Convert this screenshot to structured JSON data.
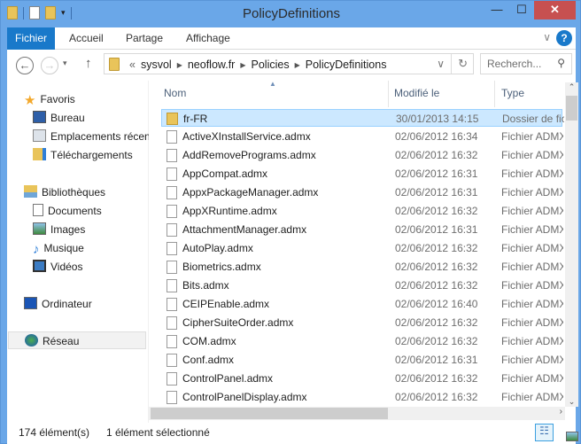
{
  "window": {
    "title": "PolicyDefinitions"
  },
  "ribbon": {
    "tabs": [
      "Fichier",
      "Accueil",
      "Partage",
      "Affichage"
    ]
  },
  "address": {
    "prefix": "«",
    "crumbs": [
      "sysvol",
      "neoflow.fr",
      "Policies",
      "PolicyDefinitions"
    ],
    "search_placeholder": "Recherch..."
  },
  "sidebar": {
    "favorites": {
      "label": "Favoris",
      "items": [
        "Bureau",
        "Emplacements récents",
        "Téléchargements"
      ]
    },
    "libraries": {
      "label": "Bibliothèques",
      "items": [
        "Documents",
        "Images",
        "Musique",
        "Vidéos"
      ]
    },
    "computer": "Ordinateur",
    "network": "Réseau"
  },
  "columns": {
    "name": "Nom",
    "modified": "Modifié le",
    "type": "Type"
  },
  "files": [
    {
      "name": "fr-FR",
      "modified": "30/01/2013 14:15",
      "type": "Dossier de fichiers",
      "folder": true
    },
    {
      "name": "ActiveXInstallService.admx",
      "modified": "02/06/2012 16:34",
      "type": "Fichier ADMX"
    },
    {
      "name": "AddRemovePrograms.admx",
      "modified": "02/06/2012 16:32",
      "type": "Fichier ADMX"
    },
    {
      "name": "AppCompat.admx",
      "modified": "02/06/2012 16:31",
      "type": "Fichier ADMX"
    },
    {
      "name": "AppxPackageManager.admx",
      "modified": "02/06/2012 16:31",
      "type": "Fichier ADMX"
    },
    {
      "name": "AppXRuntime.admx",
      "modified": "02/06/2012 16:32",
      "type": "Fichier ADMX"
    },
    {
      "name": "AttachmentManager.admx",
      "modified": "02/06/2012 16:31",
      "type": "Fichier ADMX"
    },
    {
      "name": "AutoPlay.admx",
      "modified": "02/06/2012 16:32",
      "type": "Fichier ADMX"
    },
    {
      "name": "Biometrics.admx",
      "modified": "02/06/2012 16:32",
      "type": "Fichier ADMX"
    },
    {
      "name": "Bits.admx",
      "modified": "02/06/2012 16:32",
      "type": "Fichier ADMX"
    },
    {
      "name": "CEIPEnable.admx",
      "modified": "02/06/2012 16:40",
      "type": "Fichier ADMX"
    },
    {
      "name": "CipherSuiteOrder.admx",
      "modified": "02/06/2012 16:32",
      "type": "Fichier ADMX"
    },
    {
      "name": "COM.admx",
      "modified": "02/06/2012 16:32",
      "type": "Fichier ADMX"
    },
    {
      "name": "Conf.admx",
      "modified": "02/06/2012 16:31",
      "type": "Fichier ADMX"
    },
    {
      "name": "ControlPanel.admx",
      "modified": "02/06/2012 16:32",
      "type": "Fichier ADMX"
    },
    {
      "name": "ControlPanelDisplay.admx",
      "modified": "02/06/2012 16:32",
      "type": "Fichier ADMX"
    }
  ],
  "status": {
    "count": "174 élément(s)",
    "selected": "1 élément sélectionné"
  }
}
